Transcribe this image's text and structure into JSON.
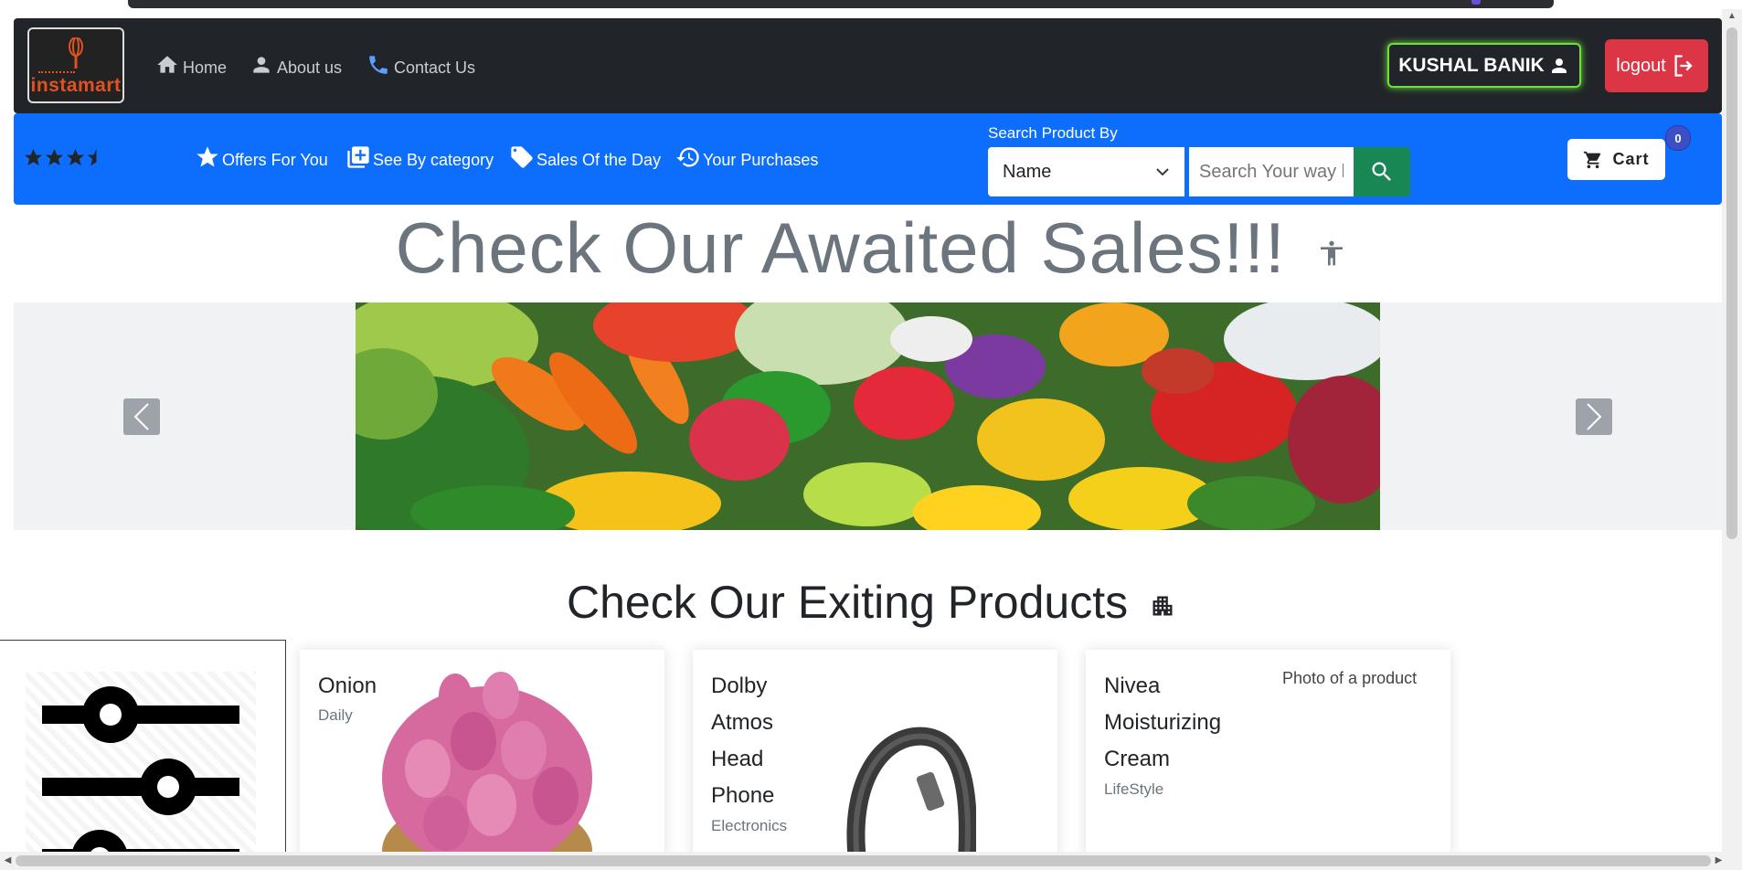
{
  "header": {
    "logo_text": "instamart",
    "nav": [
      {
        "label": "Home",
        "icon": "home-icon"
      },
      {
        "label": "About us",
        "icon": "person-icon"
      },
      {
        "label": "Contact Us",
        "icon": "phone-icon"
      }
    ],
    "user_name": "KUSHAL BANIK",
    "logout_label": "logout"
  },
  "bluebar": {
    "rating": 3.5,
    "nav": [
      {
        "label": "Offers For You",
        "icon": "star-icon"
      },
      {
        "label": "See By category",
        "icon": "library-add-icon"
      },
      {
        "label": "Sales Of the Day",
        "icon": "tag-icon"
      },
      {
        "label": "Your Purchases",
        "icon": "history-icon"
      }
    ],
    "search": {
      "label": "Search Product By",
      "selected": "Name",
      "placeholder": "Search Your way here"
    },
    "cart": {
      "label": "Cart",
      "count": "0"
    }
  },
  "sales": {
    "title": "Check Our Awaited Sales!!!"
  },
  "products": {
    "title": "Check Our Exiting Products",
    "items": [
      {
        "name": "Onion",
        "category": "Daily"
      },
      {
        "name": "Dolby Atmos Head Phone",
        "category": "Electronics"
      },
      {
        "name": "Nivea Moisturizing Cream",
        "category": "LifeStyle",
        "image_alt": "Photo of a product"
      }
    ]
  },
  "colors": {
    "header_bg": "#212529",
    "bluebar_bg": "#0d6efd",
    "logout_bg": "#dc3545",
    "search_btn_bg": "#198754",
    "user_glow": "#6fe03a"
  }
}
